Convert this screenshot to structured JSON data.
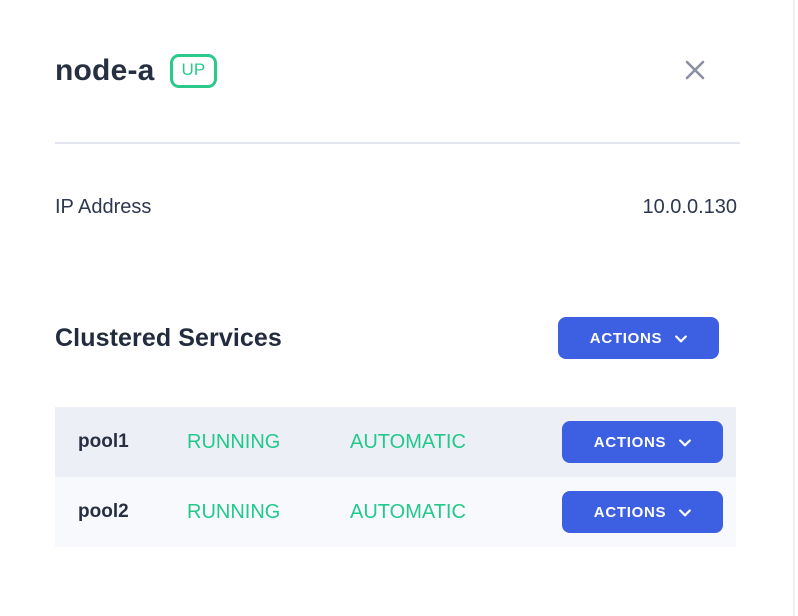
{
  "panel": {
    "title": "node-a",
    "status": "UP"
  },
  "details": [
    {
      "label": "IP Address",
      "value": "10.0.0.130"
    }
  ],
  "services": {
    "heading": "Clustered Services",
    "actions_label": "ACTIONS",
    "rows": [
      {
        "name": "pool1",
        "state": "RUNNING",
        "mode": "AUTOMATIC",
        "actions_label": "ACTIONS"
      },
      {
        "name": "pool2",
        "state": "RUNNING",
        "mode": "AUTOMATIC",
        "actions_label": "ACTIONS"
      }
    ]
  },
  "colors": {
    "accent_blue": "#3d5fe1",
    "status_green": "#22c98b",
    "badge_green": "#2bca8c",
    "dark_text": "#272f42",
    "row_odd_bg": "#edeff6",
    "row_even_bg": "#f8f9fc",
    "divider": "#e4e6ef",
    "close_gray": "#8b90a3"
  }
}
